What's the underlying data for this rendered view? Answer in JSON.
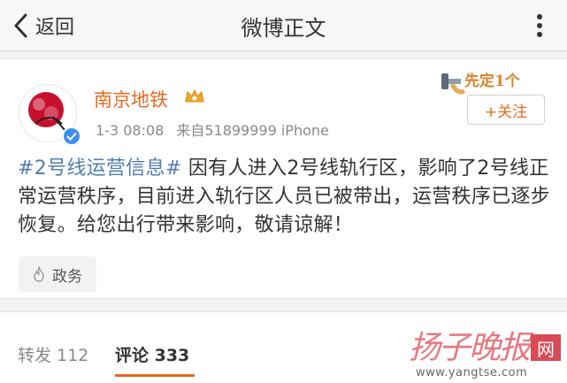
{
  "navbar": {
    "back_label": "返回",
    "title": "微博正文",
    "more_icon": "more-dots-icon"
  },
  "post": {
    "username": "南京地铁",
    "vip_icon": "vip-crown-icon",
    "time": "1-3 08:08",
    "source": "来自51899999 iPhone",
    "badge_text": "先定1个",
    "follow_label": "+关注",
    "hashtag": "#2号线运营信息#",
    "body": " 因有人进入2号线轨行区，影响了2号线正常运营秩序，目前进入轨行区人员已被带出，运营秩序已逐步恢复。给您出行带来影响，敬请谅解！",
    "tag_label": "政务",
    "tag_icon": "flame-icon"
  },
  "actions": {
    "repost_label": "转发 112",
    "comment_label": "评论 333"
  },
  "watermark": {
    "calligraphy": "扬子晚报",
    "net": "网",
    "url": "www.yangtse.com"
  },
  "colors": {
    "accent": "#e8681f",
    "hashtag": "#507daf",
    "verified": "#3f8ef2"
  }
}
